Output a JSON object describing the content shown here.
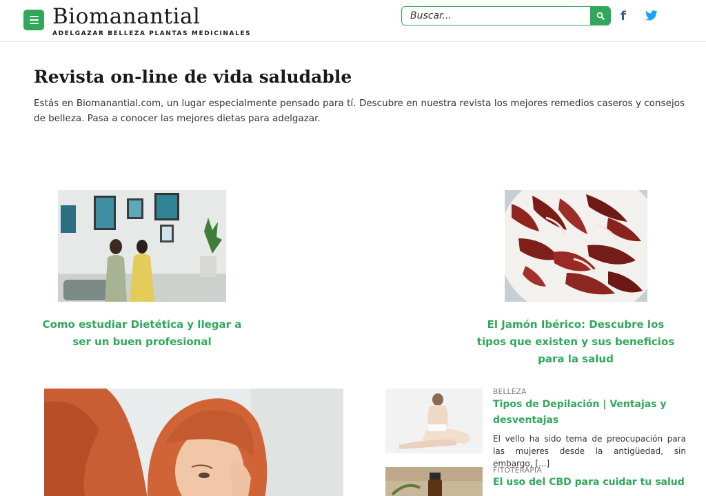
{
  "header": {
    "brand": "Biomanantial",
    "tagline": "ADELGAZAR BELLEZA PLANTAS MEDICINALES",
    "search_placeholder": "Buscar...",
    "facebook_label": "f",
    "accent_color": "#2fa85a"
  },
  "intro": {
    "title": "Revista on-line de vida saludable",
    "text": "Estás en Biomanantial.com, un lugar especialmente pensado para tí. Descubre en nuestra revista los mejores remedios caseros y consejos de belleza. Pasa a conocer las mejores dietas para adelgazar."
  },
  "featured": [
    {
      "title": "Como estudiar Dietética y llegar a ser un buen profesional",
      "image": "two-women-measuring-photo"
    },
    {
      "title": "El Jamón Ibérico: Descubre los tipos que existen y sus beneficios para la salud",
      "image": "iberian-ham-plate-photo"
    }
  ],
  "side_posts": [
    {
      "category": "BELLEZA",
      "title": "Tipos de Depilación | Ventajas y desventajas",
      "excerpt": "El vello ha sido tema de preocupación para las mujeres desde la antigüedad, sin embargo, [...]",
      "image": "woman-seated-photo"
    },
    {
      "category": "FITOTERAPIA",
      "title": "El uso del CBD para cuidar tu salud",
      "excerpt": "",
      "image": "cbd-bottle-photo"
    }
  ]
}
